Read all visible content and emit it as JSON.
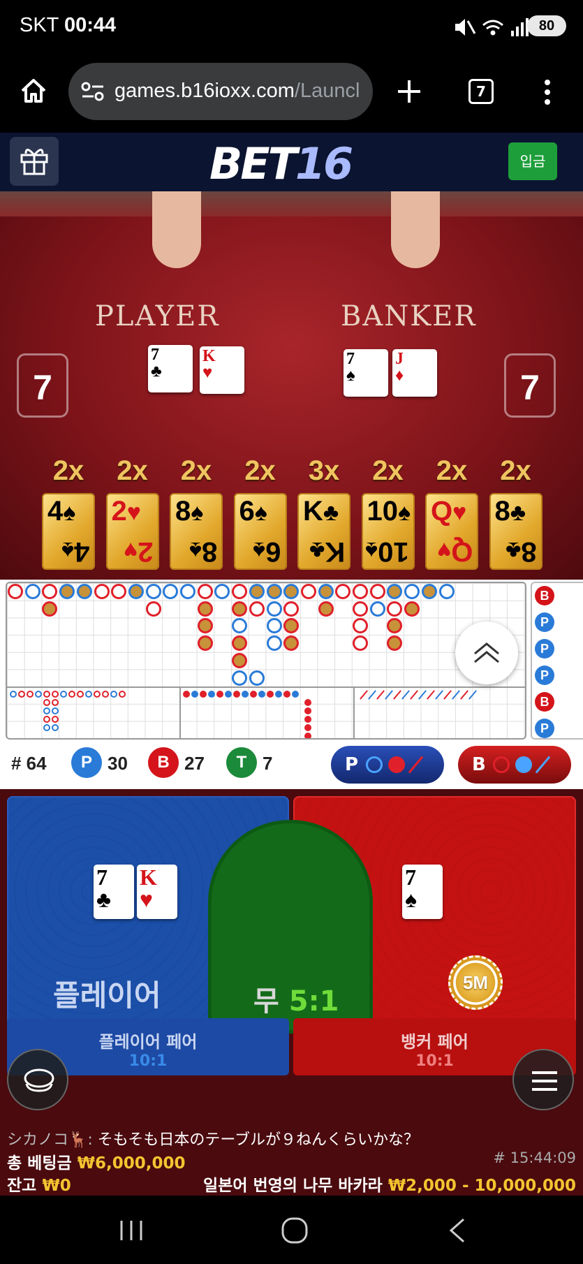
{
  "status_bar": {
    "carrier": "SKT",
    "time": "00:44",
    "battery": "80"
  },
  "browser": {
    "url_host": "games.b16ioxx.com",
    "url_path": "/Launcl",
    "tab_count": "7"
  },
  "site": {
    "logo_left": "BET",
    "logo_right": "16",
    "deposit_label": "입금"
  },
  "table": {
    "player_label": "PLAYER",
    "banker_label": "BANKER",
    "player_score": "7",
    "banker_score": "7",
    "player_cards": [
      {
        "rank": "7",
        "suit": "♣",
        "color": "black"
      },
      {
        "rank": "K",
        "suit": "♥",
        "color": "red"
      }
    ],
    "banker_cards": [
      {
        "rank": "7",
        "suit": "♠",
        "color": "black"
      },
      {
        "rank": "J",
        "suit": "♦",
        "color": "red"
      }
    ],
    "multipliers": [
      {
        "mult": "2x",
        "rank": "4",
        "suit": "♠",
        "color": "black"
      },
      {
        "mult": "2x",
        "rank": "2",
        "suit": "♥",
        "color": "red"
      },
      {
        "mult": "2x",
        "rank": "8",
        "suit": "♠",
        "color": "black"
      },
      {
        "mult": "2x",
        "rank": "6",
        "suit": "♠",
        "color": "black"
      },
      {
        "mult": "3x",
        "rank": "K",
        "suit": "♣",
        "color": "black"
      },
      {
        "mult": "2x",
        "rank": "10",
        "suit": "♠",
        "color": "black"
      },
      {
        "mult": "2x",
        "rank": "Q",
        "suit": "♥",
        "color": "red"
      },
      {
        "mult": "2x",
        "rank": "8",
        "suit": "♣",
        "color": "black"
      }
    ]
  },
  "stats": {
    "round_label": "# 64",
    "player_letter": "P",
    "player_count": "30",
    "banker_letter": "B",
    "banker_count": "27",
    "tie_letter": "T",
    "tie_count": "7",
    "predict_player": "P",
    "predict_banker": "B"
  },
  "side_badges": [
    "B",
    "P",
    "P",
    "P",
    "B",
    "P"
  ],
  "betting": {
    "player_label": "플레이어",
    "tie_label": "무",
    "tie_odds": "5:1",
    "player_pair": "플레이어 페어",
    "player_pair_odds": "10:1",
    "banker_pair": "뱅커 페어",
    "banker_pair_odds": "10:1",
    "chip_label": "5M",
    "player_cards": [
      {
        "rank": "7",
        "suit": "♣",
        "color": "black"
      },
      {
        "rank": "K",
        "suit": "♥",
        "color": "red"
      }
    ],
    "banker_cards": [
      {
        "rank": "7",
        "suit": "♠",
        "color": "black"
      }
    ]
  },
  "chat": {
    "user": "シカノコ🦌:",
    "message": " そもそも日本のテーブルが９ねんくらいかな？"
  },
  "footer": {
    "total_bet_label": "총 베팅금",
    "total_bet_value": "₩6,000,000",
    "balance_label": "잔고",
    "balance_value": "₩0",
    "round_id": "# 15:44:09",
    "table_name": "일본어 번영의 나무 바카라",
    "limits": "₩2,000 - 10,000,000"
  },
  "colors": {
    "player": "#1b4fa8",
    "banker": "#c41212",
    "tie": "#136b1a",
    "gold": "#f4c430"
  }
}
